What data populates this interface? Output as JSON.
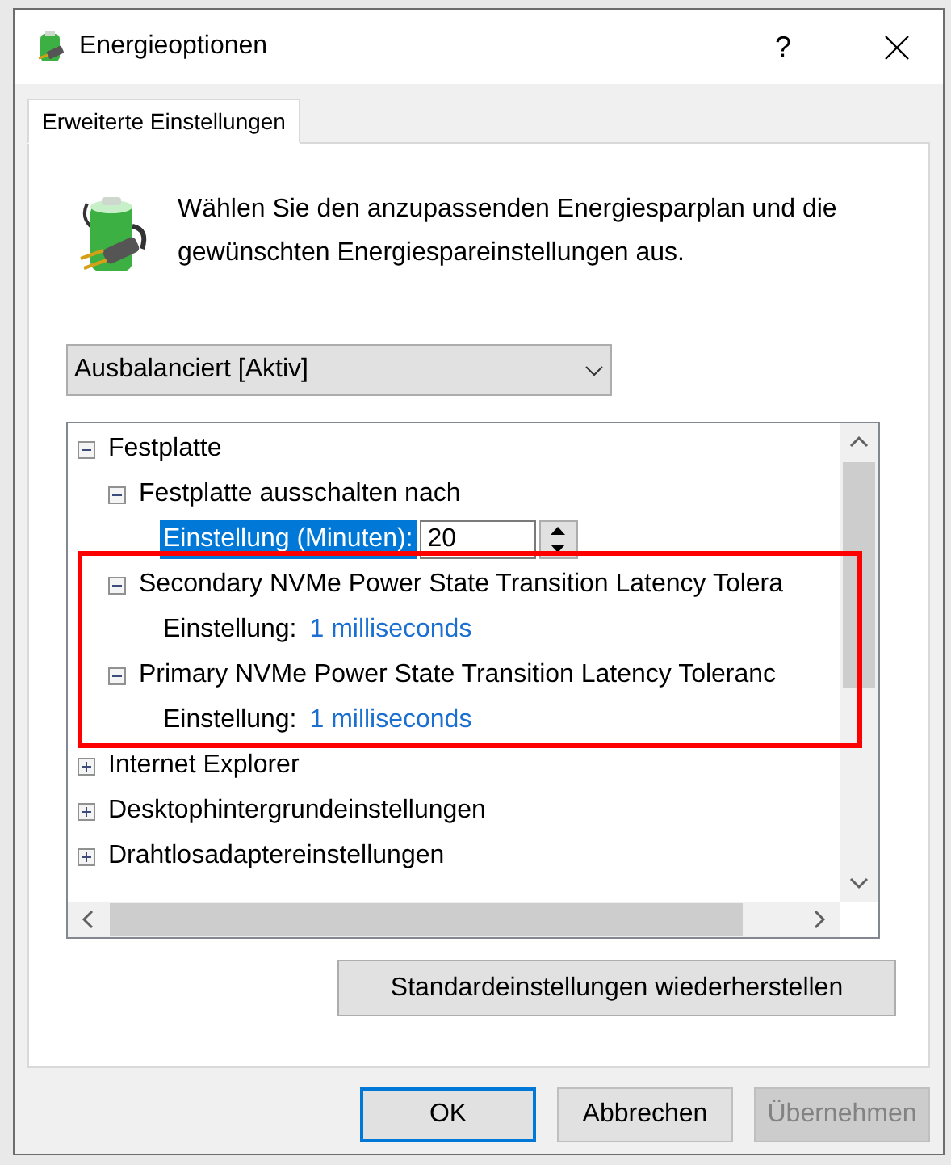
{
  "window": {
    "title": "Energieoptionen",
    "help": "?"
  },
  "tabs": [
    {
      "label": "Erweiterte Einstellungen",
      "selected": true
    }
  ],
  "intro": "Wählen Sie den anzupassenden Energiesparplan und die gewünschten Energiespareinstellungen aus.",
  "plan_select": {
    "value": "Ausbalanciert [Aktiv]"
  },
  "tree": [
    {
      "kind": "group",
      "label": "Festplatte",
      "expanded": true,
      "children": [
        {
          "kind": "group",
          "label": "Festplatte ausschalten nach",
          "expanded": true,
          "children": [
            {
              "kind": "spin",
              "label": "Einstellung (Minuten):",
              "value": "20",
              "selected": true
            }
          ]
        },
        {
          "kind": "group",
          "label": "Secondary NVMe Power State Transition Latency Tolera",
          "expanded": true,
          "children": [
            {
              "kind": "value",
              "label": "Einstellung:",
              "value": "1 milliseconds",
              "selected": false
            }
          ]
        },
        {
          "kind": "group",
          "label": "Primary NVMe Power State Transition Latency Toleranc",
          "expanded": true,
          "children": [
            {
              "kind": "value",
              "label": "Einstellung:",
              "value": "1 milliseconds",
              "selected": false
            }
          ]
        }
      ]
    },
    {
      "kind": "group",
      "label": "Internet Explorer",
      "expanded": false
    },
    {
      "kind": "group",
      "label": "Desktophintergrundeinstellungen",
      "expanded": false
    },
    {
      "kind": "group",
      "label": "Drahtlosadaptereinstellungen",
      "expanded": false
    }
  ],
  "restore_button": "Standardeinstellungen wiederherstellen",
  "buttons": [
    {
      "label": "OK",
      "kind": "default",
      "disabled": false
    },
    {
      "label": "Abbrechen",
      "kind": "normal",
      "disabled": false
    },
    {
      "label": "Übernehmen",
      "kind": "normal",
      "disabled": true
    }
  ]
}
